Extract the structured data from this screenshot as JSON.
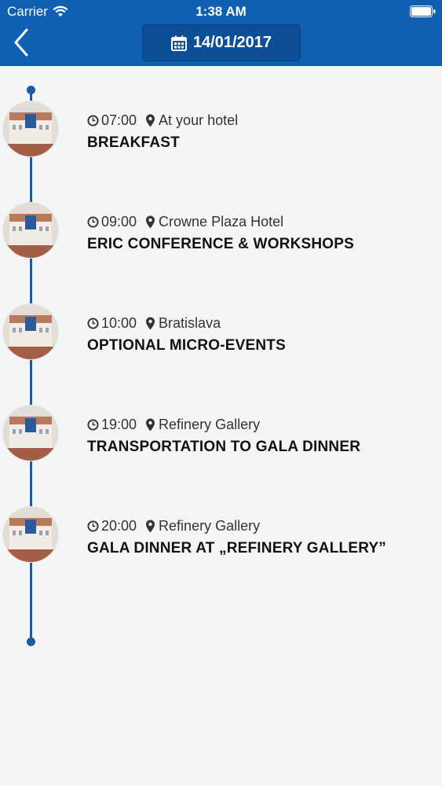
{
  "status_bar": {
    "carrier": "Carrier",
    "time": "1:38 AM"
  },
  "header": {
    "date": "14/01/2017"
  },
  "colors": {
    "header": "#0f5fb3",
    "timeline": "#1a5aa8"
  },
  "events": [
    {
      "time": "07:00",
      "location": "At your hotel",
      "title": "BREAKFAST"
    },
    {
      "time": "09:00",
      "location": "Crowne Plaza Hotel",
      "title": "ERIC CONFERENCE & WORKSHOPS"
    },
    {
      "time": "10:00",
      "location": "Bratislava",
      "title": "OPTIONAL MICRO-EVENTS"
    },
    {
      "time": "19:00",
      "location": "Refinery Gallery",
      "title": "TRANSPORTATION TO GALA DINNER"
    },
    {
      "time": "20:00",
      "location": "Refinery Gallery",
      "title": "GALA DINNER AT „REFINERY GALLERY”"
    }
  ]
}
